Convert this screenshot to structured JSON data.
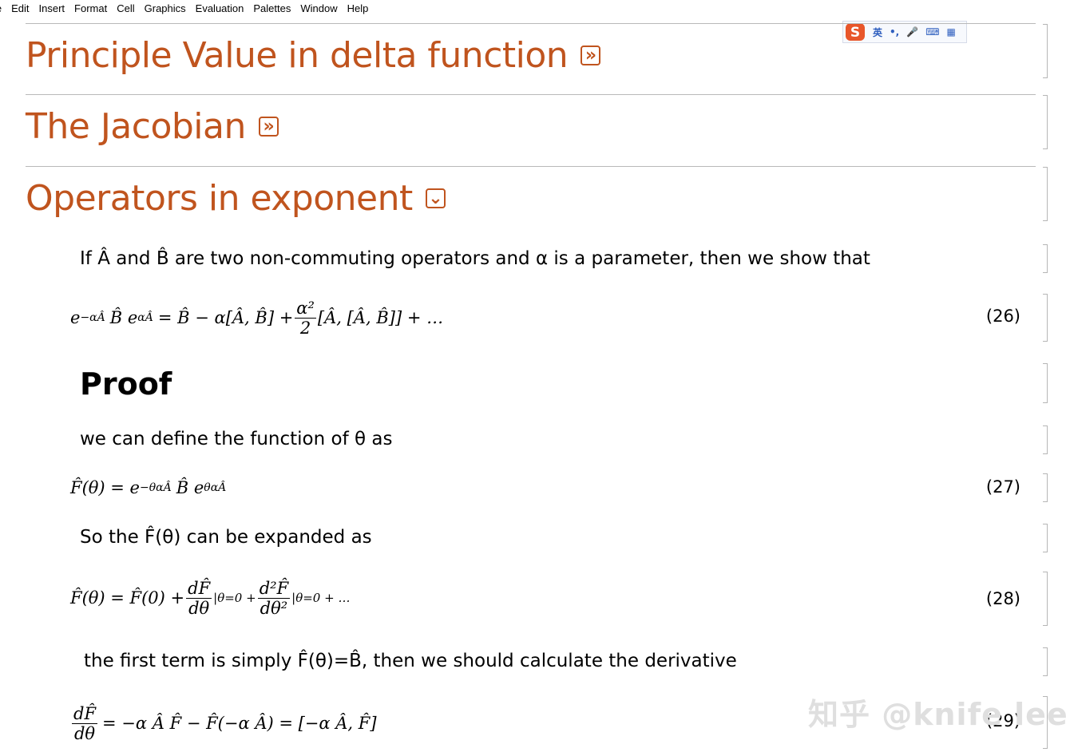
{
  "menu": [
    "le",
    "Edit",
    "Insert",
    "Format",
    "Cell",
    "Graphics",
    "Evaluation",
    "Palettes",
    "Window",
    "Help"
  ],
  "ime": {
    "lang": "英",
    "punct": "•,",
    "mic": "🎤",
    "keyboard": "⌨",
    "apps": "▦"
  },
  "sections": [
    {
      "title": "Principle Value in delta function",
      "toggle": "»"
    },
    {
      "title": "The Jacobian",
      "toggle": "»"
    },
    {
      "title": "Operators in exponent",
      "toggle": "⌄"
    }
  ],
  "content": {
    "intro": "If Â and B̂  are two non-commuting operators and α is a parameter, then we show that",
    "eq26": {
      "lhs": "e",
      "sup1": "−αÂ",
      "mid": "B̂ e",
      "sup2": "αÂ",
      "rhs1": "= B̂ − α[Â, B̂] +",
      "frac_num": "α²",
      "frac_den": "2",
      "rhs2": "[Â, [Â, B̂]] + …",
      "num": "(26)"
    },
    "proof": "Proof",
    "define": "we can define the function of θ as",
    "eq27": {
      "lhs": "F̂(θ) = e",
      "sup1": "−θαÂ",
      "mid": "B̂ e",
      "sup2": "θαÂ",
      "num": "(27)"
    },
    "expand": "So the F̂(θ) can be expanded as",
    "eq28": {
      "lhs": "F̂(θ) = F̂(0) +",
      "f1_num": "dF̂",
      "f1_den": "dθ",
      "mid": "|θ=0 +",
      "f2_num": "d²F̂",
      "f2_den": "dθ²",
      "rhs": "|θ=0 + …",
      "num": "(28)"
    },
    "firstterm": "the first term is simply F̂(θ)=B̂, then we should calculate the derivative",
    "eq29": {
      "f_num": "dF̂",
      "f_den": "dθ",
      "rhs": "= −α Â F̂ − F̂(−α Â) = [−α Â, F̂]",
      "num": "(29)"
    }
  },
  "watermark": "知乎 @knife lee",
  "colors": {
    "section": "#c0541e",
    "rule": "#b9b9b9",
    "bracket": "#b6b6b6"
  }
}
